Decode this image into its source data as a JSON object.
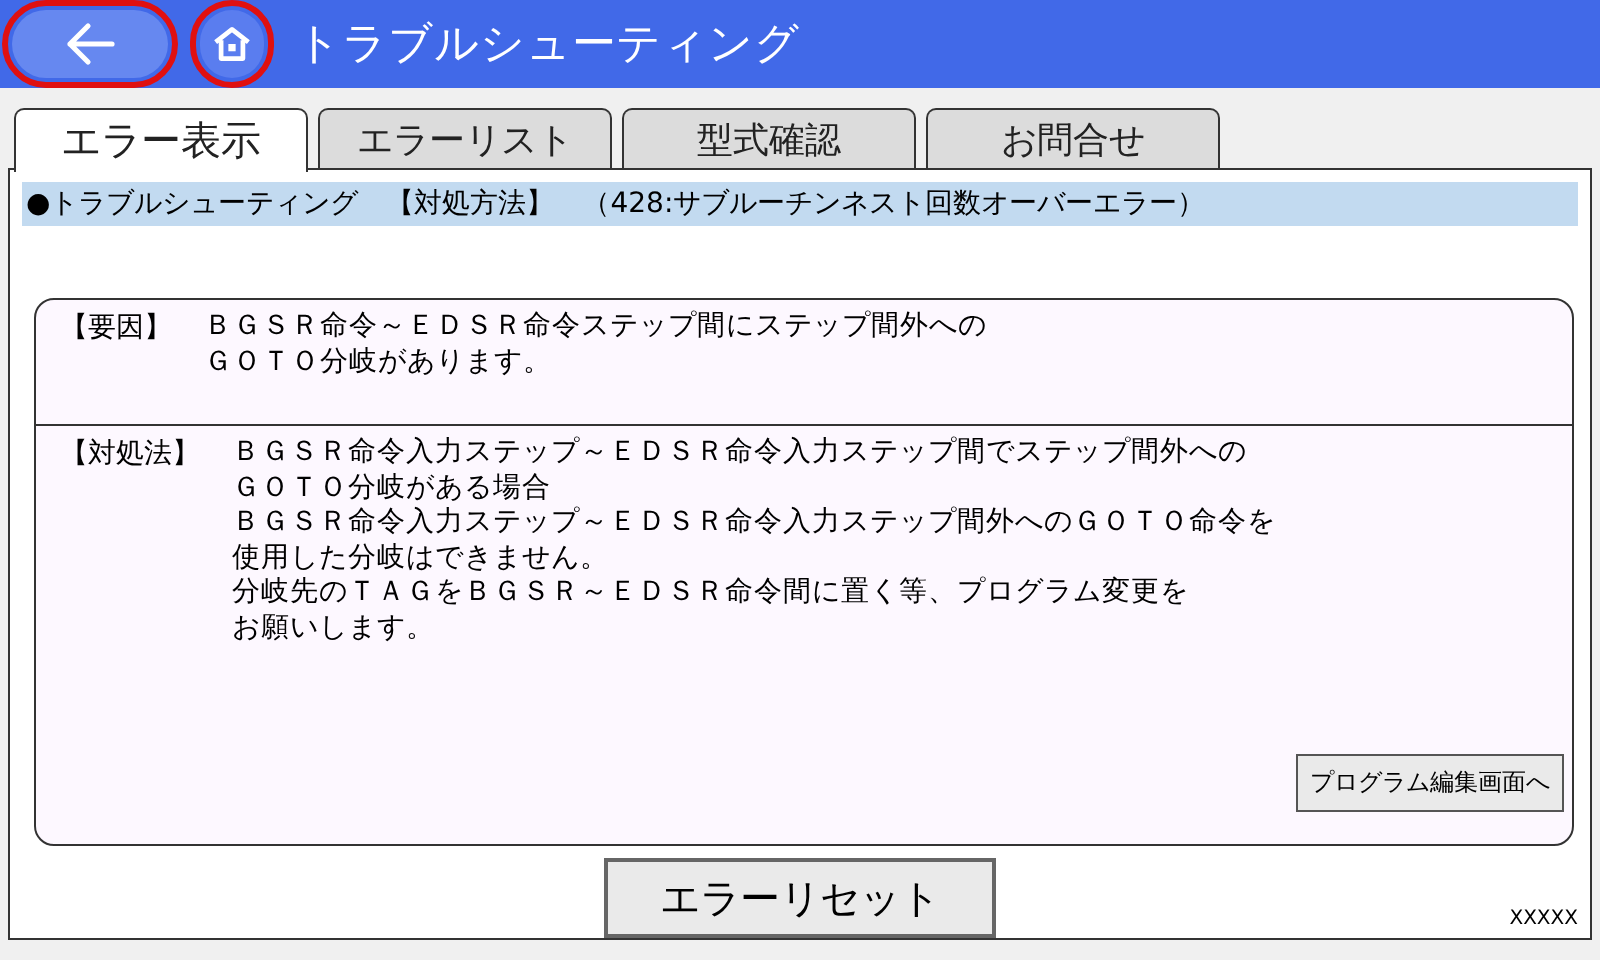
{
  "header": {
    "title": "トラブルシューティング"
  },
  "tabs": [
    {
      "label": "エラー表示",
      "selected": true
    },
    {
      "label": "エラーリスト",
      "selected": false
    },
    {
      "label": "型式確認",
      "selected": false
    },
    {
      "label": "お問合せ",
      "selected": false
    }
  ],
  "section_title": "●トラブルシューティング　【対処方法】　（428:サブルーチンネスト回数オーバーエラー）",
  "cause": {
    "label": "【要因】",
    "lines": [
      "ＢＧＳＲ命令～ＥＤＳＲ命令ステップ間にステップ間外への",
      "ＧＯＴＯ分岐があります。"
    ]
  },
  "remedy": {
    "label": "【対処法】",
    "lines": [
      "ＢＧＳＲ命令入力ステップ～ＥＤＳＲ命令入力ステップ間でステップ間外への",
      "ＧＯＴＯ分岐がある場合",
      "ＢＧＳＲ命令入力ステップ～ＥＤＳＲ命令入力ステップ間外へのＧＯＴＯ命令を",
      "使用した分岐はできません。",
      "分岐先のＴＡＧをＢＧＳＲ～ＥＤＳＲ命令間に置く等、プログラム変更を",
      "お願いします。"
    ]
  },
  "program_edit_button": "プログラム編集画面へ",
  "reset_button": "エラーリセット",
  "footer_code": "XXXXX"
}
